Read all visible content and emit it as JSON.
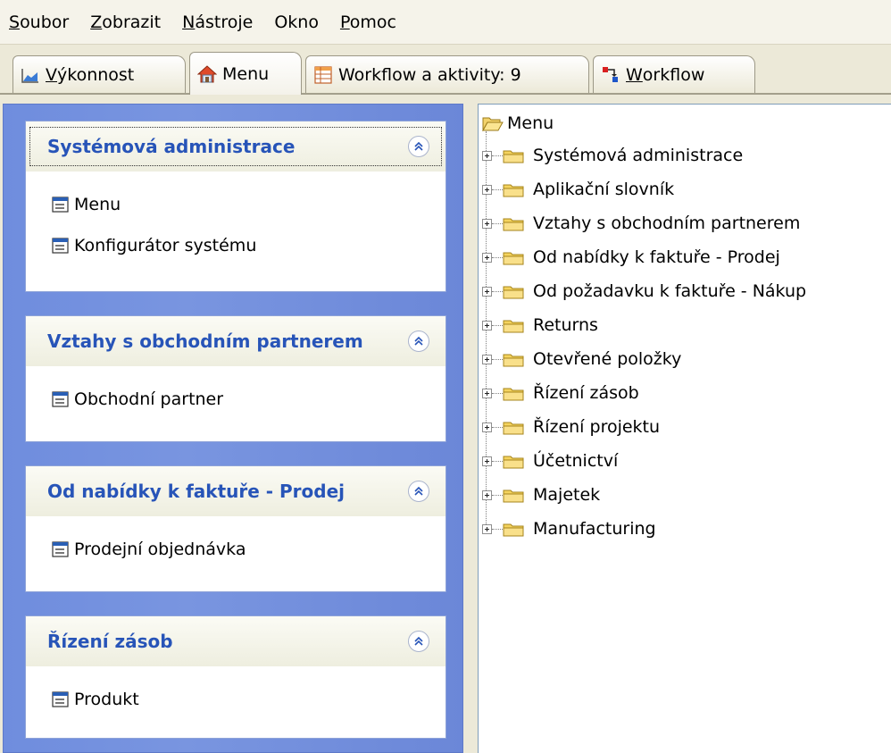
{
  "menubar": [
    {
      "id": "soubor",
      "mnemonic": "S",
      "rest": "oubor"
    },
    {
      "id": "zobrazit",
      "mnemonic": "Z",
      "rest": "obrazit"
    },
    {
      "id": "nastroje",
      "mnemonic": "N",
      "rest": "ástroje"
    },
    {
      "id": "okno",
      "mnemonic": "",
      "rest": "Okno"
    },
    {
      "id": "pomoc",
      "mnemonic": "P",
      "rest": "omoc"
    }
  ],
  "tabs": {
    "performance": {
      "mnemonic": "V",
      "rest": "ýkonnost",
      "icon": "chart-icon"
    },
    "menu": {
      "label": "Menu",
      "icon": "home-icon"
    },
    "workflow_activities": {
      "label": "Workflow a aktivity: 9",
      "icon": "table-icon"
    },
    "workflow": {
      "mnemonic": "W",
      "rest": "orkflow",
      "icon": "workflow-icon"
    },
    "active": "menu"
  },
  "left_groups": [
    {
      "title": "Systémová administrace",
      "items": [
        "Menu",
        "Konfigurátor systému"
      ]
    },
    {
      "title": "Vztahy s obchodním partnerem",
      "items": [
        "Obchodní partner"
      ]
    },
    {
      "title": "Od nabídky k faktuře - Prodej",
      "items": [
        "Prodejní objednávka"
      ]
    },
    {
      "title": "Řízení zásob",
      "items": [
        "Produkt"
      ]
    }
  ],
  "tree": {
    "root": "Menu",
    "nodes": [
      "Systémová administrace",
      "Aplikační slovník",
      "Vztahy s obchodním partnerem",
      "Od nabídky k faktuře - Prodej",
      "Od požadavku k faktuře - Nákup",
      "Returns",
      "Otevřené položky",
      "Řízení zásob",
      "Řízení projektu",
      "Účetnictví",
      "Majetek",
      "Manufacturing"
    ]
  },
  "colors": {
    "panel_blue": "#7995e0",
    "group_title": "#2754b8",
    "folder_yellow": "#f4d35e"
  }
}
